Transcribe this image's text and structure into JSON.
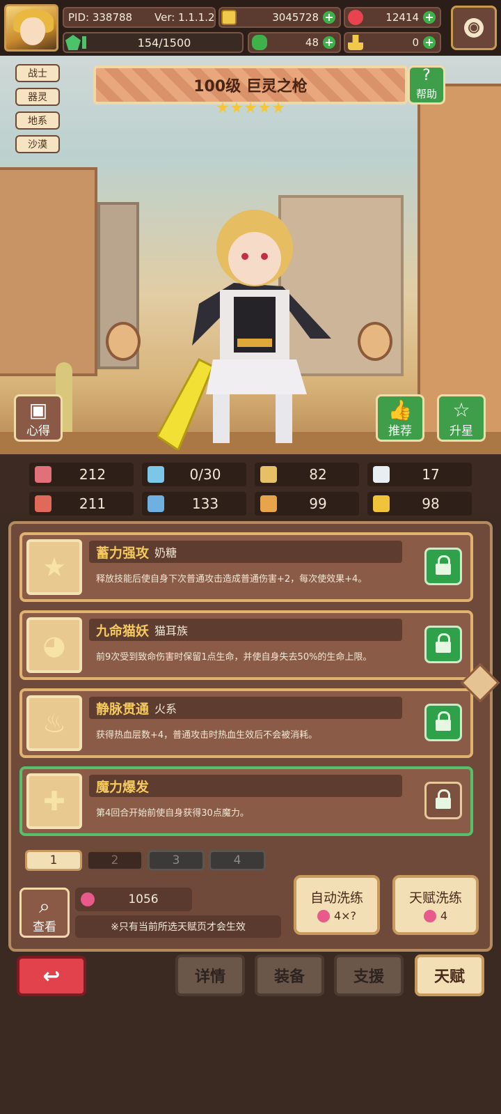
{
  "header": {
    "pid": "PID: 338788",
    "version": "Ver: 1.1.1.2",
    "gold": "3045728",
    "gems": "12414",
    "energy": "154/1500",
    "clover": "48",
    "keys": "0"
  },
  "tags": [
    "战士",
    "器灵",
    "地系",
    "沙漠"
  ],
  "title": {
    "name": "100级  巨灵之枪",
    "stars": 5
  },
  "buttons": {
    "help": "帮助",
    "notes": "心得",
    "recommend": "推荐",
    "star_up": "升星",
    "view": "查看",
    "auto_refine": "自动洗练",
    "auto_refine_cost": "4×?",
    "talent_refine": "天赋洗练",
    "talent_refine_cost": "4"
  },
  "stats": [
    {
      "icon": "heart-icon",
      "value": "212",
      "color": "#e0707a"
    },
    {
      "icon": "mana-drop-icon",
      "value": "0/30",
      "color": "#7cc6e8"
    },
    {
      "icon": "shield-icon",
      "value": "82",
      "color": "#e6c067"
    },
    {
      "icon": "wing-icon",
      "value": "17",
      "color": "#e8eef2"
    },
    {
      "icon": "fist-icon",
      "value": "211",
      "color": "#e06a5a"
    },
    {
      "icon": "book-icon",
      "value": "133",
      "color": "#6fb0e0"
    },
    {
      "icon": "stairs-icon",
      "value": "99",
      "color": "#e8a44a"
    },
    {
      "icon": "horseshoe-icon",
      "value": "98",
      "color": "#f0c43a"
    }
  ],
  "talents": [
    {
      "name": "蓄力强攻",
      "tag": "奶糖",
      "desc": "释放技能后使自身下次普通攻击造成普通伤害+2，每次使效果+4。",
      "icon": "star-icon"
    },
    {
      "name": "九命猫妖",
      "tag": "猫耳族",
      "desc": "前9次受到致命伤害时保留1点生命，并使自身失去50%的生命上限。",
      "icon": "cat-icon"
    },
    {
      "name": "静脉贯通",
      "tag": "火系",
      "desc": "获得热血层数+4，普通攻击时热血生效后不会被消耗。",
      "icon": "fire-icon"
    },
    {
      "name": "魔力爆发",
      "tag": "",
      "desc": "第4回合开始前使自身获得30点魔力。",
      "icon": "cross-icon"
    }
  ],
  "pages": [
    "1",
    "2",
    "3",
    "4"
  ],
  "currency": {
    "amount": "1056"
  },
  "note": "※只有当前所选天赋页才会生效",
  "nav": {
    "details": "详情",
    "equipment": "装备",
    "support": "支援",
    "talent": "天赋"
  }
}
